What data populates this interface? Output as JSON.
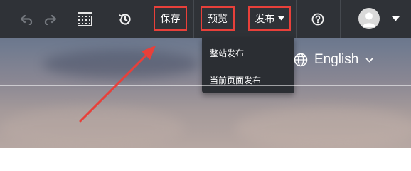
{
  "toolbar": {
    "undo_icon": "undo-icon",
    "redo_icon": "redo-icon",
    "grid_icon": "grid-icon",
    "history_icon": "history-icon",
    "save_label": "保存",
    "preview_label": "预览",
    "publish_label": "发布",
    "help_icon": "help-icon",
    "avatar_icon": "user-icon"
  },
  "publish_menu": {
    "items": [
      {
        "label": "整站发布"
      },
      {
        "label": "当前页面发布"
      }
    ]
  },
  "language": {
    "label": "English"
  },
  "colors": {
    "toolbar_bg": "#2f3237",
    "highlight_border": "#e8403a",
    "arrow": "#e8403a",
    "dropdown_bg": "#2b2e33"
  }
}
